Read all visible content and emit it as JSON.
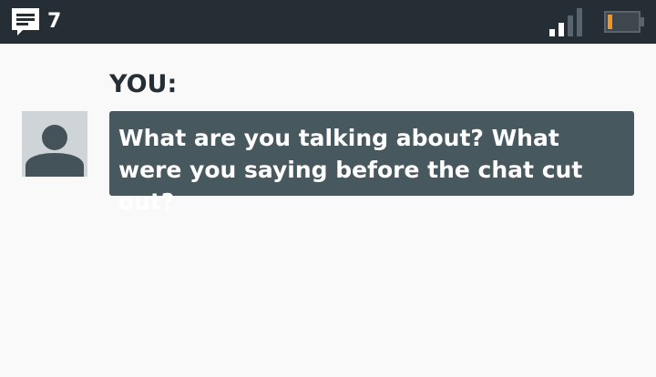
{
  "status_bar": {
    "message_count": "7",
    "icons": {
      "messages": "chat-bubble-icon",
      "signal": "signal-strength-icon",
      "battery": "battery-low-icon"
    },
    "colors": {
      "bar_background": "#262e35",
      "battery_level": "#f7941d"
    },
    "signal_level": 0.5,
    "battery_level": 0.1
  },
  "chat": {
    "sender": "YOU:",
    "message": "What are you talking about? What were you saying before the chat cut out?",
    "colors": {
      "bubble_background": "#47585f",
      "avatar_background": "#cfd4d8"
    }
  }
}
